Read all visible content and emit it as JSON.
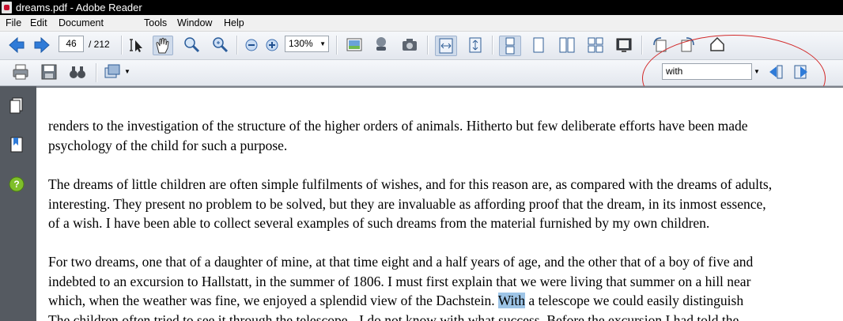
{
  "window": {
    "title": "dreams.pdf - Adobe Reader"
  },
  "menu": [
    "File",
    "Edit",
    "Document",
    "Tools",
    "Window",
    "Help"
  ],
  "toolbar": {
    "page_current": "46",
    "page_total": "/ 212",
    "zoom_value": "130%"
  },
  "find": {
    "value": "with"
  },
  "document": {
    "paragraphs": [
      {
        "lines": [
          "renders to the investigation of the structure of the higher orders of animals. Hitherto but few deliberate efforts have been made",
          "psychology of the child for such a purpose."
        ]
      },
      {
        "lines": [
          "The dreams of little children are often simple fulfilments of wishes, and for this reason are, as compared with the dreams of adults,",
          "interesting. They present no problem to be solved, but they are invaluable as affording proof that the dream, in its inmost essence,",
          "of a wish. I have been able to collect several examples of such dreams from the material furnished by my own children."
        ]
      },
      {
        "lines": [
          "For two dreams, one that of a daughter of mine, at that time eight and a half years of age, and the other that of a boy of five and",
          "indebted to an excursion to Hallstatt, in the summer of 1806. I must first explain that we were living that summer on a hill near",
          "The children often tried to see it through the telescope - I do not know with what success. Before the excursion I had told the"
        ],
        "highlight_line": {
          "before": "which, when the weather was fine, we enjoyed a splendid view of the Dachstein. ",
          "match": "With",
          "after": " a telescope we could easily distinguish"
        }
      }
    ]
  }
}
